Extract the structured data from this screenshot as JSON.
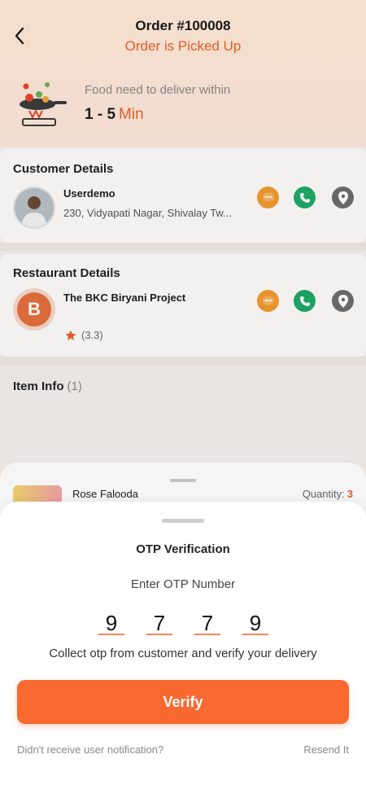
{
  "header": {
    "order_title": "Order #100008",
    "order_status": "Order is Picked Up",
    "deliver_label": "Food need to deliver within",
    "deliver_value": "1 - 5",
    "deliver_unit": "Min"
  },
  "customer": {
    "section_title": "Customer Details",
    "name": "Userdemo",
    "address": "230, Vidyapati Nagar, Shivalay Tw..."
  },
  "restaurant": {
    "section_title": "Restaurant Details",
    "name": "The BKC Biryani Project",
    "logo_letter": "B",
    "rating": "(3.3)"
  },
  "items": {
    "section_title": "Item Info",
    "count": "(1)",
    "list": [
      {
        "name": "Rose Falooda",
        "quantity_label": "Quantity:",
        "quantity": "3"
      }
    ]
  },
  "otp": {
    "title": "OTP Verification",
    "label": "Enter OTP Number",
    "digits": [
      "9",
      "7",
      "7",
      "9"
    ],
    "hint": "Collect otp from customer and verify your delivery",
    "verify_label": "Verify",
    "no_notification": "Didn't receive user notification?",
    "resend_label": "Resend It"
  },
  "colors": {
    "accent": "#f7692f",
    "status": "#e8622a",
    "call": "#1ea968",
    "chat": "#f29a2e",
    "location": "#6d6d6d"
  },
  "icons": [
    "back-arrow-icon",
    "chat-icon",
    "phone-icon",
    "location-pin-icon",
    "star-icon"
  ]
}
